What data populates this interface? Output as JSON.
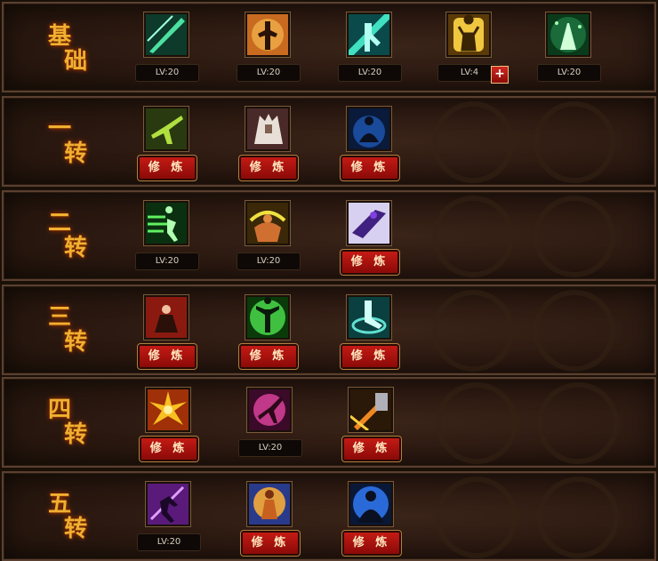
{
  "rows": [
    {
      "title": [
        "基",
        "础"
      ],
      "skills": [
        {
          "icon": "green-slash-icon",
          "level": "LV:20"
        },
        {
          "icon": "warrior-silhouette-icon",
          "level": "LV:20"
        },
        {
          "icon": "green-fighter-icon",
          "level": "LV:20"
        },
        {
          "icon": "golden-monk-icon",
          "level": "LV:4",
          "plus": "+"
        },
        {
          "icon": "praying-hands-icon",
          "level": "LV:20"
        }
      ]
    },
    {
      "title": [
        "一",
        "转"
      ],
      "skills": [
        {
          "icon": "green-kick-icon",
          "train": "修 炼"
        },
        {
          "icon": "white-warrior-icon",
          "train": "修 炼"
        },
        {
          "icon": "meditating-monk-icon",
          "train": "修 炼"
        }
      ]
    },
    {
      "title": [
        "二",
        "转"
      ],
      "skills": [
        {
          "icon": "green-dash-icon",
          "level": "LV:20"
        },
        {
          "icon": "muscle-power-icon",
          "level": "LV:20"
        },
        {
          "icon": "purple-strike-icon",
          "train": "修 炼"
        }
      ]
    },
    {
      "title": [
        "三",
        "转"
      ],
      "skills": [
        {
          "icon": "seated-master-icon",
          "train": "修 炼"
        },
        {
          "icon": "green-aura-icon",
          "train": "修 炼"
        },
        {
          "icon": "whirlwind-kick-icon",
          "train": "修 炼"
        }
      ]
    },
    {
      "title": [
        "四",
        "转"
      ],
      "skills": [
        {
          "icon": "fire-explosion-icon",
          "train": "修 炼"
        },
        {
          "icon": "pink-flying-kick-icon",
          "level": "LV:20"
        },
        {
          "icon": "fire-sword-icon",
          "train": "修 炼"
        }
      ]
    },
    {
      "title": [
        "五",
        "转"
      ],
      "skills": [
        {
          "icon": "purple-lunge-icon",
          "level": "LV:20"
        },
        {
          "icon": "golden-deity-icon",
          "train": "修 炼"
        },
        {
          "icon": "blue-shadow-icon",
          "train": "修 炼"
        }
      ]
    }
  ]
}
